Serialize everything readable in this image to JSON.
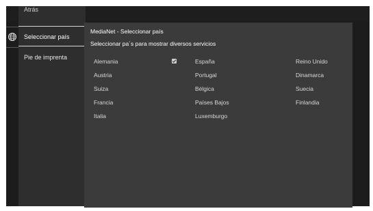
{
  "sidebar": {
    "back_label": "Atrás",
    "items": [
      {
        "label": "Seleccionar país"
      },
      {
        "label": "Pie de imprenta"
      }
    ]
  },
  "main": {
    "title": "MediaNet - Seleccionar país",
    "subtitle": "Seleccionar pa´s para mostrar diversos servicios",
    "countries_col1": [
      "Alemania",
      "Austria",
      "Suiza",
      "Francia",
      "Italia"
    ],
    "countries_col2": [
      "España",
      "Portugal",
      "Bélgica",
      "Países Bajos",
      "Luxemburgo"
    ],
    "countries_col3": [
      "Reino Unido",
      "Dinamarca",
      "Suecia",
      "Finlandia"
    ],
    "selected": "Alemania"
  },
  "icons": {
    "globe": "globe-icon",
    "check": "checkbox-checked-icon"
  },
  "colors": {
    "background": "#1c1c1c",
    "sidebar": "#2e2e2e",
    "content": "#3b3b3b",
    "text": "#ffffff"
  }
}
